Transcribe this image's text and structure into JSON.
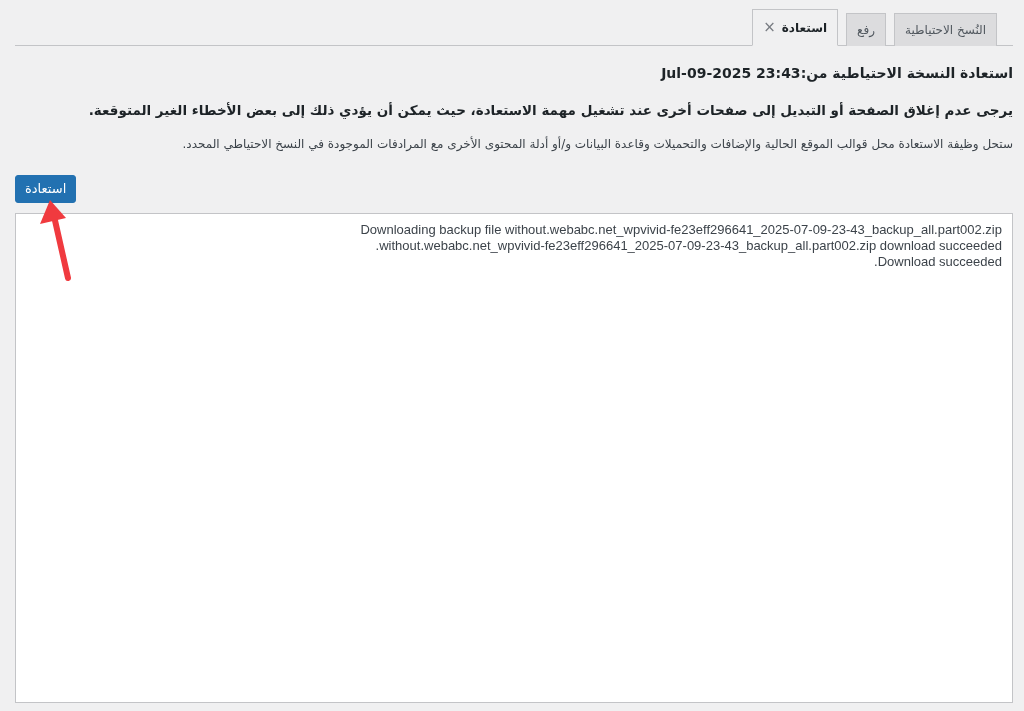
{
  "tabs": [
    {
      "label": "النُسخ الاحتياطية",
      "selected": false,
      "closable": false
    },
    {
      "label": "رفع",
      "selected": false,
      "closable": false
    },
    {
      "label": "استعادة",
      "selected": true,
      "closable": true,
      "close_glyph": "×"
    }
  ],
  "restore": {
    "title": "استعادة النسخة الاحتياطية من:23:43 Jul-09-2025",
    "warning": "يرجى عدم إغلاق الصفحة أو التبديل إلى صفحات أخرى عند تشغيل مهمة الاستعادة، حيث يمكن أن يؤدي ذلك إلى بعض الأخطاء الغير المتوقعة.",
    "description": "ستحل وظيفة الاستعادة محل قوالب الموقع الحالية والإضافات والتحميلات وقاعدة البيانات و/أو أدلة المحتوى الأخرى مع المرادفات الموجودة في النسخ الاحتياطي المحدد.",
    "button": "استعادة"
  },
  "log": {
    "lines": [
      "Downloading backup file without.webabc.net_wpvivid-fe23eff296641_2025-07-09-23-43_backup_all.part002.zip",
      "without.webabc.net_wpvivid-fe23eff296641_2025-07-09-23-43_backup_all.part002.zip download succeeded.",
      "Download succeeded."
    ]
  }
}
